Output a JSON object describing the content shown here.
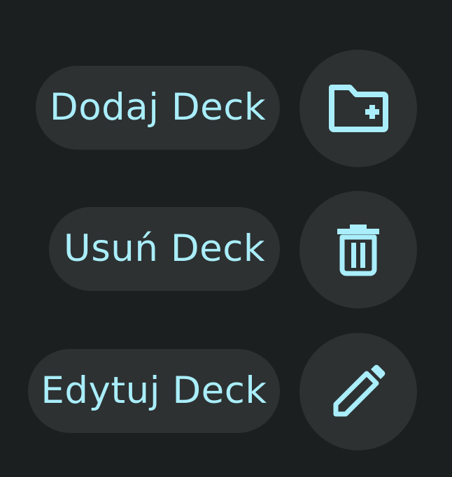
{
  "colors": {
    "background": "#1b1f20",
    "surface": "#2d3132",
    "accent": "#a9eefa"
  },
  "actions": [
    {
      "label": "Dodaj Deck",
      "icon": "folder-add-icon"
    },
    {
      "label": "Usuń Deck",
      "icon": "trash-icon"
    },
    {
      "label": "Edytuj Deck",
      "icon": "pencil-icon"
    }
  ]
}
